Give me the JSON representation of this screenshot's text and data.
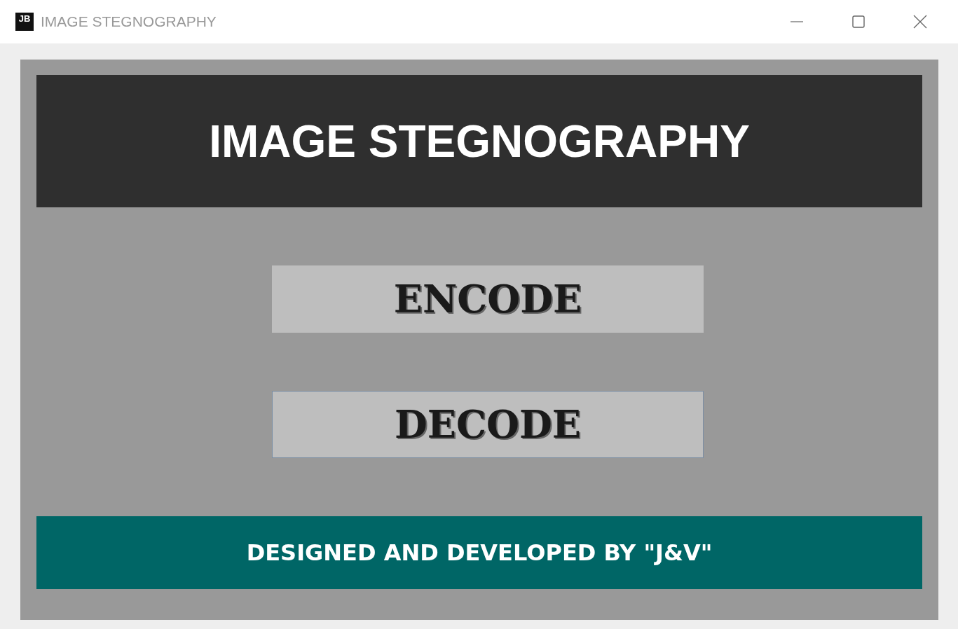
{
  "window": {
    "logo": "JB",
    "title": "IMAGE STEGNOGRAPHY"
  },
  "header": {
    "title": "IMAGE STEGNOGRAPHY"
  },
  "buttons": [
    {
      "label": "ENCODE",
      "focused": false
    },
    {
      "label": "DECODE",
      "focused": true
    }
  ],
  "footer": {
    "text": "DESIGNED AND DEVELOPED BY \"J&V\""
  }
}
